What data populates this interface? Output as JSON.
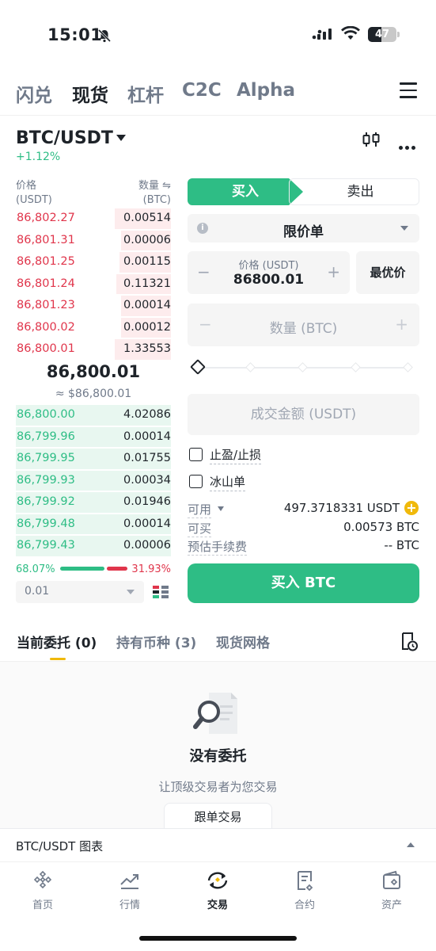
{
  "status_bar": {
    "time": "15:01",
    "battery": "47"
  },
  "top_tabs": [
    "闪兑",
    "现货",
    "杠杆",
    "C2C",
    "Alpha"
  ],
  "top_tabs_active": 1,
  "pair": {
    "symbol": "BTC/USDT",
    "change": "+1.12%"
  },
  "order_book": {
    "price_header": "价格",
    "price_unit": "(USDT)",
    "qty_header": "数量 ⇋",
    "qty_unit": "(BTC)",
    "asks": [
      {
        "price": "86,802.27",
        "qty": "0.00514",
        "depth": 0.36
      },
      {
        "price": "86,801.31",
        "qty": "0.00006",
        "depth": 0.32
      },
      {
        "price": "86,801.25",
        "qty": "0.00115",
        "depth": 0.33
      },
      {
        "price": "86,801.24",
        "qty": "0.11321",
        "depth": 0.35
      },
      {
        "price": "86,801.23",
        "qty": "0.00014",
        "depth": 0.32
      },
      {
        "price": "86,800.02",
        "qty": "0.00012",
        "depth": 0.32
      },
      {
        "price": "86,800.01",
        "qty": "1.33553",
        "depth": 0.36
      }
    ],
    "mid_price": "86,800.01",
    "mid_usd": "≈ $86,800.01",
    "bids": [
      {
        "price": "86,800.00",
        "qty": "4.02086",
        "depth": 1.0
      },
      {
        "price": "86,799.96",
        "qty": "0.00014",
        "depth": 1.0
      },
      {
        "price": "86,799.95",
        "qty": "0.01755",
        "depth": 1.0
      },
      {
        "price": "86,799.93",
        "qty": "0.00034",
        "depth": 1.0
      },
      {
        "price": "86,799.92",
        "qty": "0.01946",
        "depth": 1.0
      },
      {
        "price": "86,799.48",
        "qty": "0.00014",
        "depth": 1.0
      },
      {
        "price": "86,799.43",
        "qty": "0.00006",
        "depth": 1.0
      }
    ],
    "buy_ratio": "68.07%",
    "sell_ratio": "31.93%",
    "precision": "0.01"
  },
  "form": {
    "buy_label": "买入",
    "sell_label": "卖出",
    "order_type": "限价单",
    "info_glyph": "i",
    "price_label": "价格 (USDT)",
    "price_value": "86800.01",
    "best_price_label": "最优价",
    "qty_placeholder": "数量 (BTC)",
    "total_placeholder": "成交金额 (USDT)",
    "tp_sl_label": "止盈/止损",
    "iceberg_label": "冰山单",
    "available_label": "可用",
    "available_value": "497.3718331 USDT",
    "can_buy_label": "可买",
    "can_buy_value": "0.00573 BTC",
    "fee_label": "预估手续费",
    "fee_value": "-- BTC",
    "submit_label": "买入 BTC",
    "minus": "−",
    "plus": "+"
  },
  "orders_tabs": [
    "当前委托 (0)",
    "持有币种 (3)",
    "现货网格"
  ],
  "empty_state": {
    "title": "没有委托",
    "subtitle": "让顶级交易者为您交易",
    "button": "跟单交易"
  },
  "chart_bar_label": "BTC/USDT 图表",
  "nav": [
    {
      "label": "首页",
      "icon": "home-icon"
    },
    {
      "label": "行情",
      "icon": "markets-icon"
    },
    {
      "label": "交易",
      "icon": "trade-icon"
    },
    {
      "label": "合约",
      "icon": "futures-icon"
    },
    {
      "label": "资产",
      "icon": "wallet-icon"
    }
  ],
  "colors": {
    "green": "#2ebd85",
    "red": "#e0354b",
    "yellow": "#f0b90b"
  }
}
